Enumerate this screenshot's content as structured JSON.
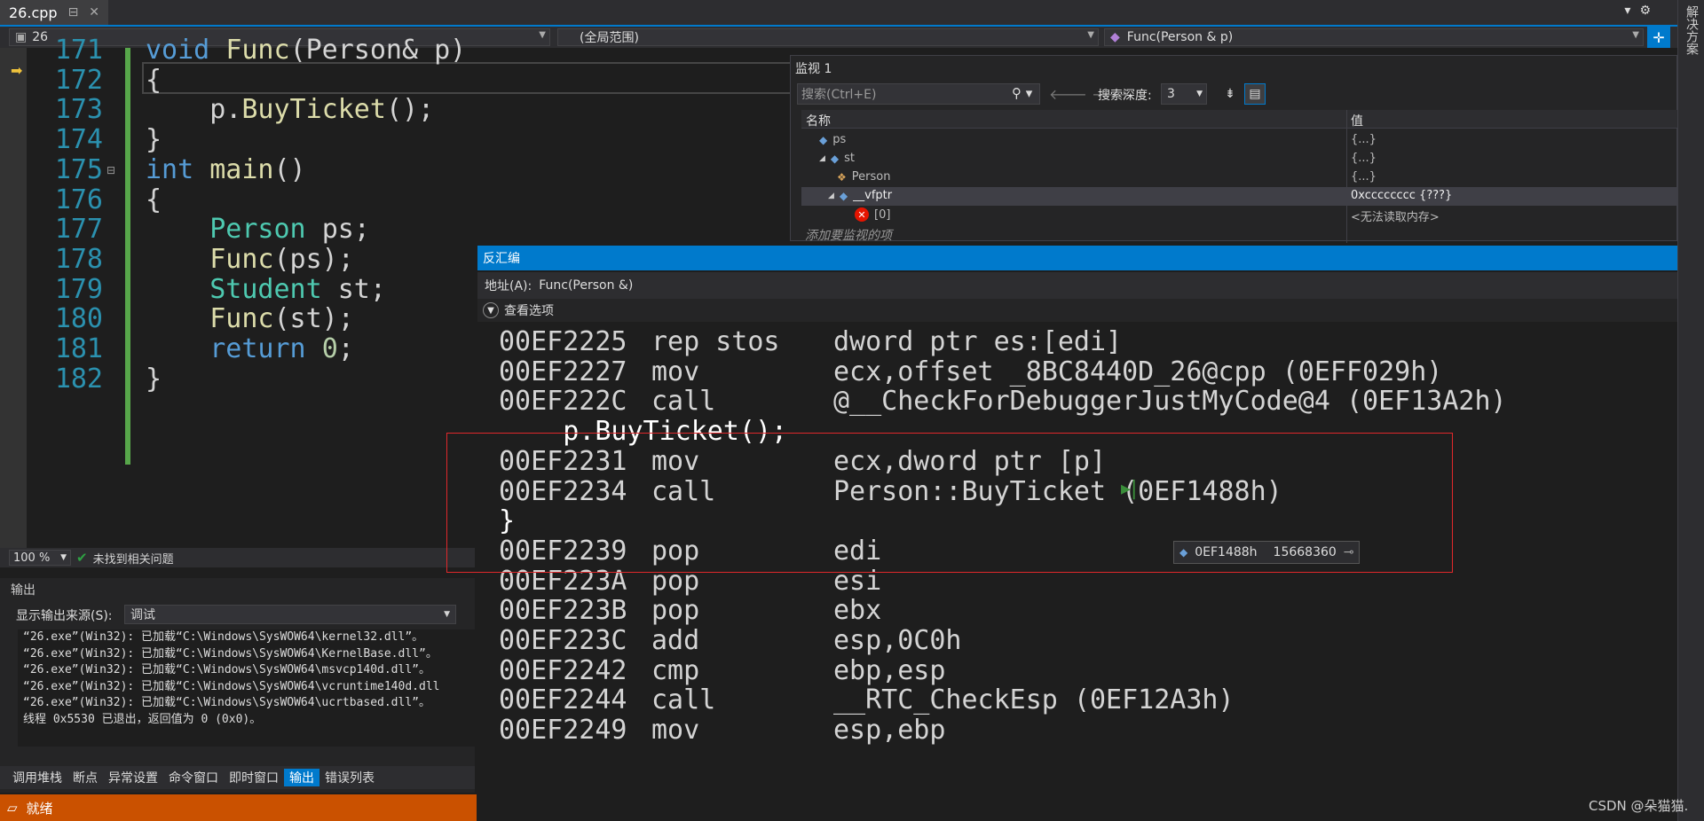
{
  "tab": {
    "filename": "26.cpp",
    "pin_glyph": "⊟",
    "close_glyph": "✕"
  },
  "topbar": {
    "dropdown_glyph": "▾",
    "gear_glyph": "⚙",
    "solution_label": "解决方案"
  },
  "navbar": {
    "project": "26",
    "scope": "(全局范围)",
    "function": "Func(Person & p)"
  },
  "editor": {
    "lines": [
      {
        "num": "171",
        "tokens": [
          {
            "t": "kw",
            "v": "void "
          },
          {
            "t": "fn",
            "v": "Func"
          },
          {
            "t": "id",
            "v": "(Person& p)"
          }
        ]
      },
      {
        "num": "172",
        "tokens": [
          {
            "t": "id",
            "v": "{"
          }
        ]
      },
      {
        "num": "173",
        "tokens": [
          {
            "t": "id",
            "v": "    p."
          },
          {
            "t": "fn",
            "v": "BuyTicket"
          },
          {
            "t": "id",
            "v": "();"
          }
        ]
      },
      {
        "num": "174",
        "tokens": [
          {
            "t": "id",
            "v": "}"
          }
        ]
      },
      {
        "num": "175",
        "tokens": [
          {
            "t": "kw",
            "v": "int "
          },
          {
            "t": "fn",
            "v": "main"
          },
          {
            "t": "id",
            "v": "()"
          }
        ]
      },
      {
        "num": "176",
        "tokens": [
          {
            "t": "id",
            "v": "{"
          }
        ]
      },
      {
        "num": "177",
        "tokens": [
          {
            "t": "ty",
            "v": "    Person "
          },
          {
            "t": "id",
            "v": "ps;"
          }
        ]
      },
      {
        "num": "178",
        "tokens": [
          {
            "t": "fn",
            "v": "    Func"
          },
          {
            "t": "id",
            "v": "(ps);"
          }
        ]
      },
      {
        "num": "179",
        "tokens": [
          {
            "t": "ty",
            "v": "    Student "
          },
          {
            "t": "id",
            "v": "st;"
          }
        ]
      },
      {
        "num": "180",
        "tokens": [
          {
            "t": "fn",
            "v": "    Func"
          },
          {
            "t": "id",
            "v": "(st);"
          }
        ]
      },
      {
        "num": "181",
        "tokens": [
          {
            "t": "kw",
            "v": "    return "
          },
          {
            "t": "num",
            "v": "0"
          },
          {
            "t": "id",
            "v": ";"
          }
        ]
      },
      {
        "num": "182",
        "tokens": [
          {
            "t": "id",
            "v": "}"
          }
        ]
      }
    ]
  },
  "editor_status": {
    "zoom": "100 %",
    "issues": "未找到相关问题"
  },
  "output": {
    "title": "输出",
    "source_label": "显示输出来源(S):",
    "source_value": "调试",
    "lines": [
      "“26.exe”(Win32): 已加载“C:\\Windows\\SysWOW64\\kernel32.dll”。",
      "“26.exe”(Win32): 已加载“C:\\Windows\\SysWOW64\\KernelBase.dll”。",
      "“26.exe”(Win32): 已加载“C:\\Windows\\SysWOW64\\msvcp140d.dll”。",
      "“26.exe”(Win32): 已加载“C:\\Windows\\SysWOW64\\vcruntime140d.dll",
      "“26.exe”(Win32): 已加载“C:\\Windows\\SysWOW64\\ucrtbased.dll”。",
      "线程 0x5530 已退出，返回值为 0 (0x0)。"
    ],
    "tabs": [
      "调用堆栈",
      "断点",
      "异常设置",
      "命令窗口",
      "即时窗口",
      "输出",
      "错误列表"
    ],
    "active_tab": "输出"
  },
  "statusbar": {
    "text": "就绪"
  },
  "watch": {
    "title": "监视 1",
    "search_placeholder": "搜索(Ctrl+E)",
    "depth_label": "搜索深度:",
    "depth_value": "3",
    "col_name": "名称",
    "col_value": "值",
    "rows": [
      {
        "name": "ps",
        "value": "{...}",
        "expander": "",
        "icon": "cube-icon"
      },
      {
        "name": "st",
        "value": "{...}",
        "expander": "◢",
        "icon": "cube-icon"
      },
      {
        "name": "Person",
        "value": "{...}",
        "expander": "",
        "icon": "class-icon"
      },
      {
        "name": "__vfptr",
        "value": "0xcccccccc {???}",
        "expander": "◢",
        "icon": "cube-icon"
      },
      {
        "name": "[0]",
        "value": "<无法读取内存>",
        "expander": "",
        "icon": "error-icon"
      },
      {
        "name": "添加要监视的项",
        "value": "",
        "expander": "",
        "icon": ""
      }
    ]
  },
  "disasm": {
    "title": "反汇编",
    "address_label": "地址(A):",
    "address_value": "Func(Person &)",
    "view_options": "查看选项",
    "lines": [
      {
        "addr": "00EF2225",
        "mn": "rep stos",
        "op": "dword ptr es:[edi]"
      },
      {
        "addr": "00EF2227",
        "mn": "mov",
        "op": "ecx,offset _8BC8440D_26@cpp (0EFF029h)"
      },
      {
        "addr": "00EF222C",
        "mn": "call",
        "op": "@__CheckForDebuggerJustMyCode@4 (0EF13A2h)"
      },
      {
        "src": "    p.BuyTicket();"
      },
      {
        "addr": "00EF2231",
        "mn": "mov",
        "op": "ecx,dword ptr [p]"
      },
      {
        "addr": "00EF2234",
        "mn": "call",
        "op": "Person::BuyTicket (0EF1488h)"
      },
      {
        "src": "}"
      },
      {
        "addr": "00EF2239",
        "mn": "pop",
        "op": "edi"
      },
      {
        "addr": "00EF223A",
        "mn": "pop",
        "op": "esi"
      },
      {
        "addr": "00EF223B",
        "mn": "pop",
        "op": "ebx"
      },
      {
        "addr": "00EF223C",
        "mn": "add",
        "op": "esp,0C0h"
      },
      {
        "addr": "00EF2242",
        "mn": "cmp",
        "op": "ebp,esp"
      },
      {
        "addr": "00EF2244",
        "mn": "call",
        "op": "__RTC_CheckEsp (0EF12A3h)"
      },
      {
        "addr": "00EF2249",
        "mn": "mov",
        "op": "esp,ebp"
      }
    ],
    "tooltip": {
      "addr": "0EF1488h",
      "value": "15668360"
    }
  },
  "watermark": "CSDN @朵猫猫."
}
